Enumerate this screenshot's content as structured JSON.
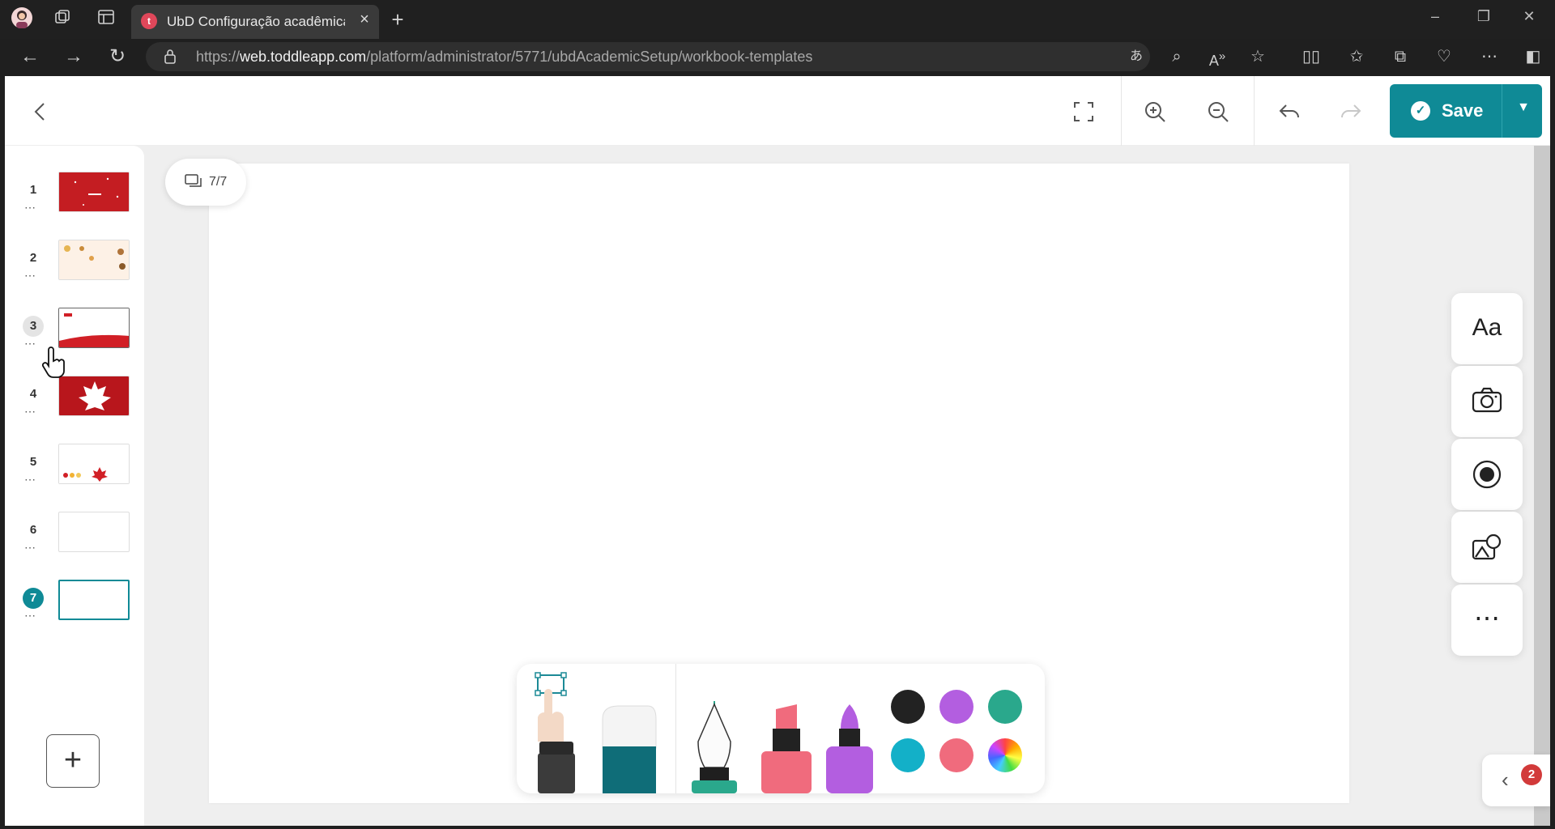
{
  "browser": {
    "tab_title": "UbD Configuração acadêmica - M",
    "tab_favicon_letter": "t",
    "url_host": "web.toddleapp.com",
    "url_path": "/platform/administrator/5771/ubdAcademicSetup/workbook-templates",
    "url_scheme": "https://"
  },
  "toolbar": {
    "save_label": "Save"
  },
  "sidebar": {
    "slides": [
      {
        "number": "1",
        "thumb": "red-pattern"
      },
      {
        "number": "2",
        "thumb": "cream-leaves"
      },
      {
        "number": "3",
        "thumb": "white-red-wave"
      },
      {
        "number": "4",
        "thumb": "maple-leaf"
      },
      {
        "number": "5",
        "thumb": "light-icons"
      },
      {
        "number": "6",
        "thumb": "blank"
      },
      {
        "number": "7",
        "thumb": "blank-active"
      }
    ],
    "active_slide": "7",
    "add_label": "+"
  },
  "canvas": {
    "page_indicator": "7/7"
  },
  "right_tools": {
    "text_label": "Aa",
    "more_label": "⋯"
  },
  "notifications": {
    "count": "2"
  },
  "draw_colors": [
    "#222222",
    "#b35ee0",
    "#2aa88c",
    "#13b0c8",
    "#f06b7d",
    "rainbow"
  ],
  "accent_color": "#0f8a96"
}
